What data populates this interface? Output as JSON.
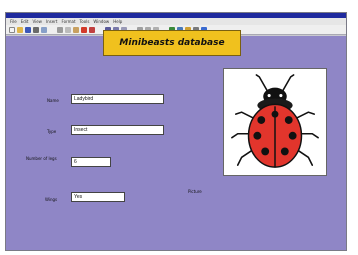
{
  "menu": [
    "File",
    "Edit",
    "View",
    "Insert",
    "Format",
    "Tools",
    "Window",
    "Help"
  ],
  "toolbar_icons": [
    "new-icon",
    "open-icon",
    "save-icon",
    "print-icon",
    "preview-icon",
    "cut-icon",
    "copy-icon",
    "paste-icon",
    "undo-icon",
    "redo-icon",
    "bold-icon",
    "italic-icon",
    "underline-icon",
    "align-left-icon",
    "align-center-icon",
    "align-right-icon",
    "table-icon",
    "image-icon",
    "chart-icon",
    "zoom-icon",
    "help-icon"
  ],
  "title": "Minibeasts database",
  "fields": {
    "name": {
      "label": "Name",
      "value": "Ladybird"
    },
    "type": {
      "label": "Type",
      "value": "Insect"
    },
    "legs": {
      "label": "Number of legs",
      "value": "6"
    },
    "wings": {
      "label": "Wings",
      "value": "Yes"
    }
  },
  "picture": {
    "label": "Picture",
    "subject": "ladybird-image"
  }
}
